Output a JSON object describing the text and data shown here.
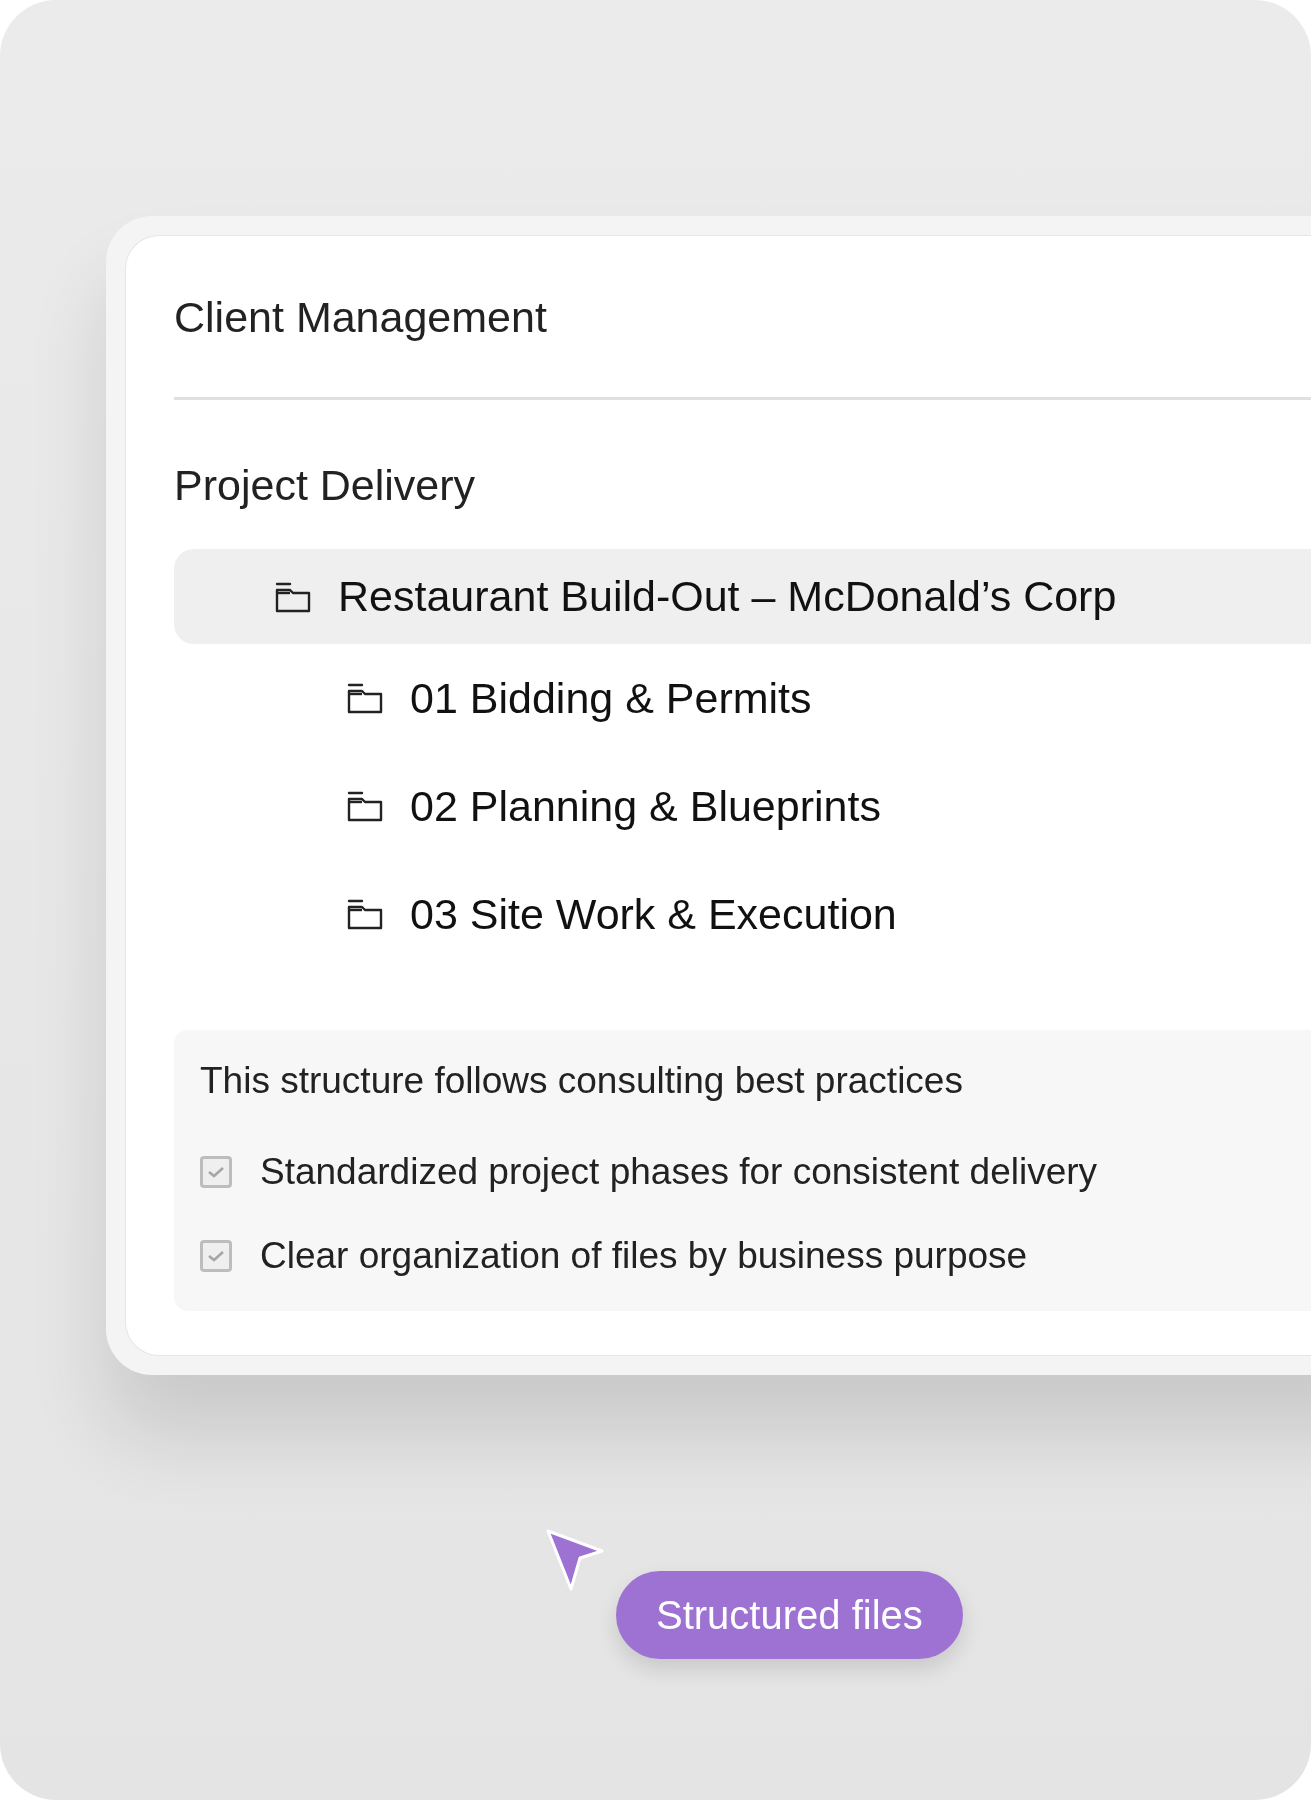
{
  "header": {
    "title": "Client Management"
  },
  "section": {
    "title": "Project Delivery",
    "folders": [
      {
        "name": "Restaurant Build-Out – McDonald’s Corp",
        "selected": true,
        "children": [
          {
            "name": "01 Bidding & Permits",
            "selected": false
          },
          {
            "name": "02 Planning & Blueprints",
            "selected": false
          },
          {
            "name": "03 Site Work & Execution",
            "selected": false
          }
        ]
      }
    ]
  },
  "info": {
    "title": "This structure follows consulting best practices",
    "items": [
      {
        "label": "Standardized project phases for consistent delivery",
        "checked": true
      },
      {
        "label": "Clear organization of files by business purpose",
        "checked": true
      }
    ]
  },
  "tooltip": {
    "label": "Structured files"
  }
}
